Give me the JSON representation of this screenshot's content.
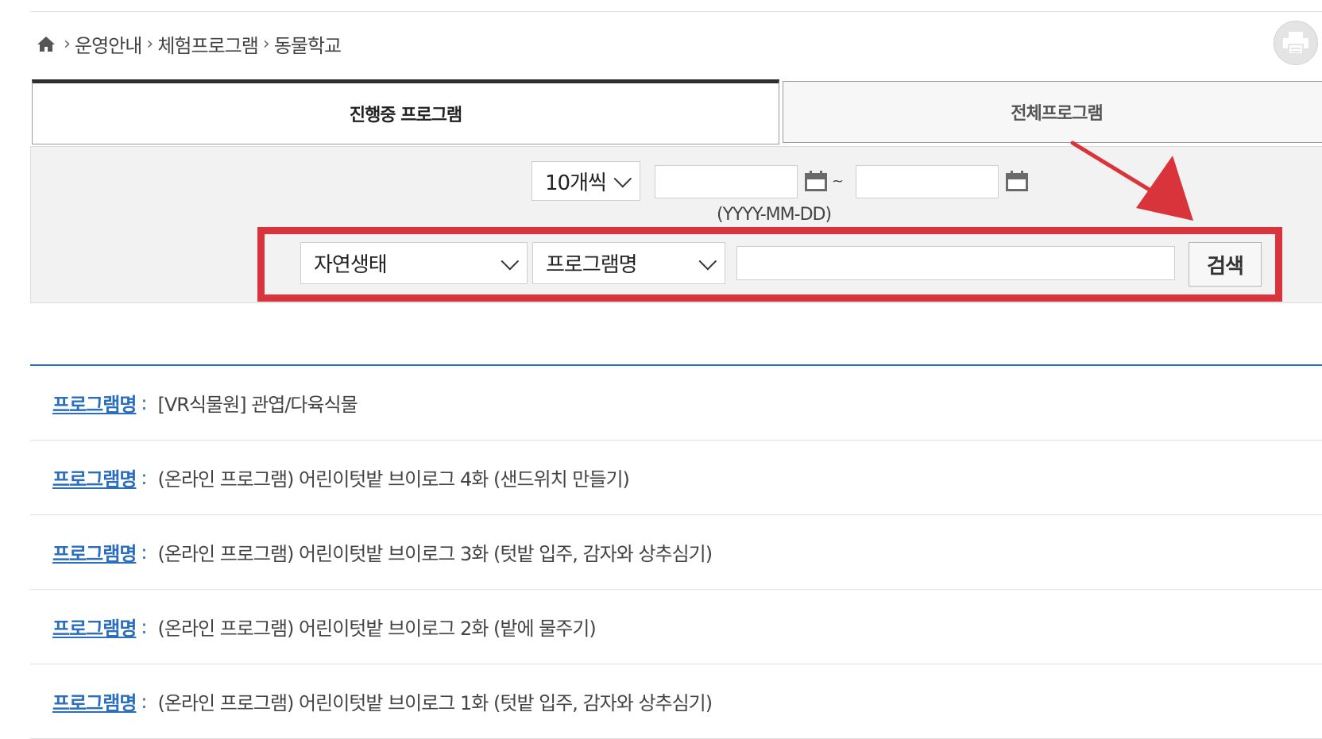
{
  "breadcrumb": {
    "items": [
      "운영안내",
      "체험프로그램",
      "동물학교"
    ],
    "icon": "home-icon"
  },
  "tabs": {
    "active": "진행중 프로그램",
    "inactive": "전체프로그램"
  },
  "search": {
    "per_page": "10개씩",
    "date_start": "",
    "date_end": "",
    "date_separator": "~",
    "date_hint": "(YYYY-MM-DD)",
    "category": "자연생태",
    "field": "프로그램명",
    "keyword": "",
    "button": "검색"
  },
  "highlight": {
    "box_color": "#d9343c",
    "arrow_color": "#d9343c"
  },
  "list": {
    "label": "프로그램명",
    "colon": ":",
    "items": [
      "[VR식물원] 관엽/다육식물",
      "(온라인 프로그램) 어린이텃밭 브이로그 4화 (샌드위치 만들기)",
      "(온라인 프로그램) 어린이텃밭 브이로그 3화 (텃밭 입주, 감자와 상추심기)",
      "(온라인 프로그램) 어린이텃밭 브이로그 2화 (밭에 물주기)",
      "(온라인 프로그램) 어린이텃밭 브이로그 1화 (텃밭 입주, 감자와 상추심기)"
    ]
  },
  "accent_color": "#2a6ebd"
}
